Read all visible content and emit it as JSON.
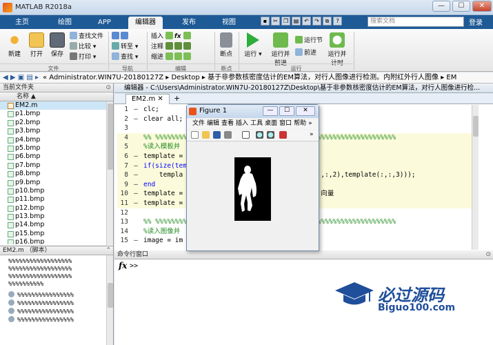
{
  "window": {
    "title": "MATLAB R2018a",
    "min_label": "—",
    "max_label": "☐",
    "close_label": "✕"
  },
  "tabs": [
    {
      "label": "主页",
      "active": false
    },
    {
      "label": "绘图",
      "active": false
    },
    {
      "label": "APP",
      "active": false
    },
    {
      "label": "编辑器",
      "active": true
    },
    {
      "label": "发布",
      "active": false
    },
    {
      "label": "视图",
      "active": false
    }
  ],
  "search": {
    "placeholder": "搜索文档"
  },
  "login": "登录",
  "ribbon": {
    "file": {
      "new": "新建",
      "open": "打开",
      "save": "保存",
      "find_files": "查找文件",
      "compare": "比较",
      "print": "打印",
      "group": "文件"
    },
    "nav": {
      "goto": "转至",
      "find": "查找",
      "group": "导航"
    },
    "edit": {
      "insert": "插入",
      "comment": "注释",
      "indent": "缩进",
      "fx": "fx",
      "group": "编辑"
    },
    "breakpoints": {
      "label": "断点",
      "group": "断点"
    },
    "run": {
      "run": "运行",
      "run_advance": "运行并\n前进",
      "run_section": "运行节",
      "advance": "前进",
      "run_time": "运行并\n计时",
      "group": "运行"
    }
  },
  "address": {
    "path": "« Administrator.WIN7U-20180127Z ▸ Desktop ▸ 基于非参数核密度估计的EM算法，对行人图像进行检测。内附红外行人图像 ▸ EM"
  },
  "current_folder": {
    "title": "当前文件夹",
    "column": "名称 ▲",
    "files": [
      "EM2.m",
      "p1.bmp",
      "p2.bmp",
      "p3.bmp",
      "p4.bmp",
      "p5.bmp",
      "p6.bmp",
      "p7.bmp",
      "p8.bmp",
      "p9.bmp",
      "p10.bmp",
      "p11.bmp",
      "p12.bmp",
      "p13.bmp",
      "p14.bmp",
      "p15.bmp",
      "p16.bmp"
    ]
  },
  "details": {
    "title": "EM2.m （脚本）",
    "text_lines": [
      "%%%%%%%%%%%%%%%%%%",
      "%%%%%%%%%%%%%%%%%%",
      "%%%%%%%%%%%%%%%%%%",
      "%%%%%%%%%%"
    ],
    "icon_lines": [
      "%%%%%%%%%%%%%%%%",
      "%%%%%%%%%%%%%%%%",
      "%%%%%%%%%%%%%%%%",
      "%%%%%%%%%%%%%%%%"
    ]
  },
  "editor": {
    "title": "编辑器 - C:\\Users\\Administrator.WIN7U-20180127Z\\Desktop\\基于非参数核密度估计的EM算法，对行人图像进行检...",
    "tab": "EM2.m",
    "add_tab": "+",
    "lines": [
      {
        "n": "1",
        "d": "—",
        "code": "clc;"
      },
      {
        "n": "2",
        "d": "—",
        "code": "clear all;"
      },
      {
        "n": "3",
        "d": "",
        "code": ""
      },
      {
        "n": "4",
        "d": "",
        "code": "%% %%%%%%%%%%%%%%%%%%%%%%%%%%%%%%%%%%%%%%%%%%%%%%%%%%%%%%%%%%%%%"
      },
      {
        "n": "5",
        "d": "",
        "code": "%读入模板并"
      },
      {
        "n": "6",
        "d": "—",
        "code": "template ="
      },
      {
        "n": "7",
        "d": "—",
        "code": "if(size(tem"
      },
      {
        "n": "8",
        "d": "—",
        "code": "    templa                                 (:,:,2),template(:,:,3)));"
      },
      {
        "n": "9",
        "d": "—",
        "code": "end"
      },
      {
        "n": "10",
        "d": "—",
        "code": "template =                                   向量"
      },
      {
        "n": "11",
        "d": "—",
        "code": "template ="
      },
      {
        "n": "12",
        "d": "",
        "code": ""
      },
      {
        "n": "13",
        "d": "",
        "code": "%% %%%%%%%%%%%%%%%%%%%%%%%%%%%%%%%%%%%%%%%%%%%%%%%%%%%%%%%%%%%%%"
      },
      {
        "n": "14",
        "d": "",
        "code": "%读入图像并"
      },
      {
        "n": "15",
        "d": "—",
        "code": "image = im"
      }
    ]
  },
  "figure": {
    "title": "Figure 1",
    "menu": [
      "文件",
      "编辑",
      "查看",
      "插入",
      "工具",
      "桌面",
      "窗口",
      "帮助"
    ],
    "more": "»"
  },
  "command_window": {
    "title": "命令行窗口",
    "fx": "fx",
    "prompt": ">>"
  },
  "watermark": {
    "line1": "必过源码",
    "line2": "Biguo100.com"
  }
}
